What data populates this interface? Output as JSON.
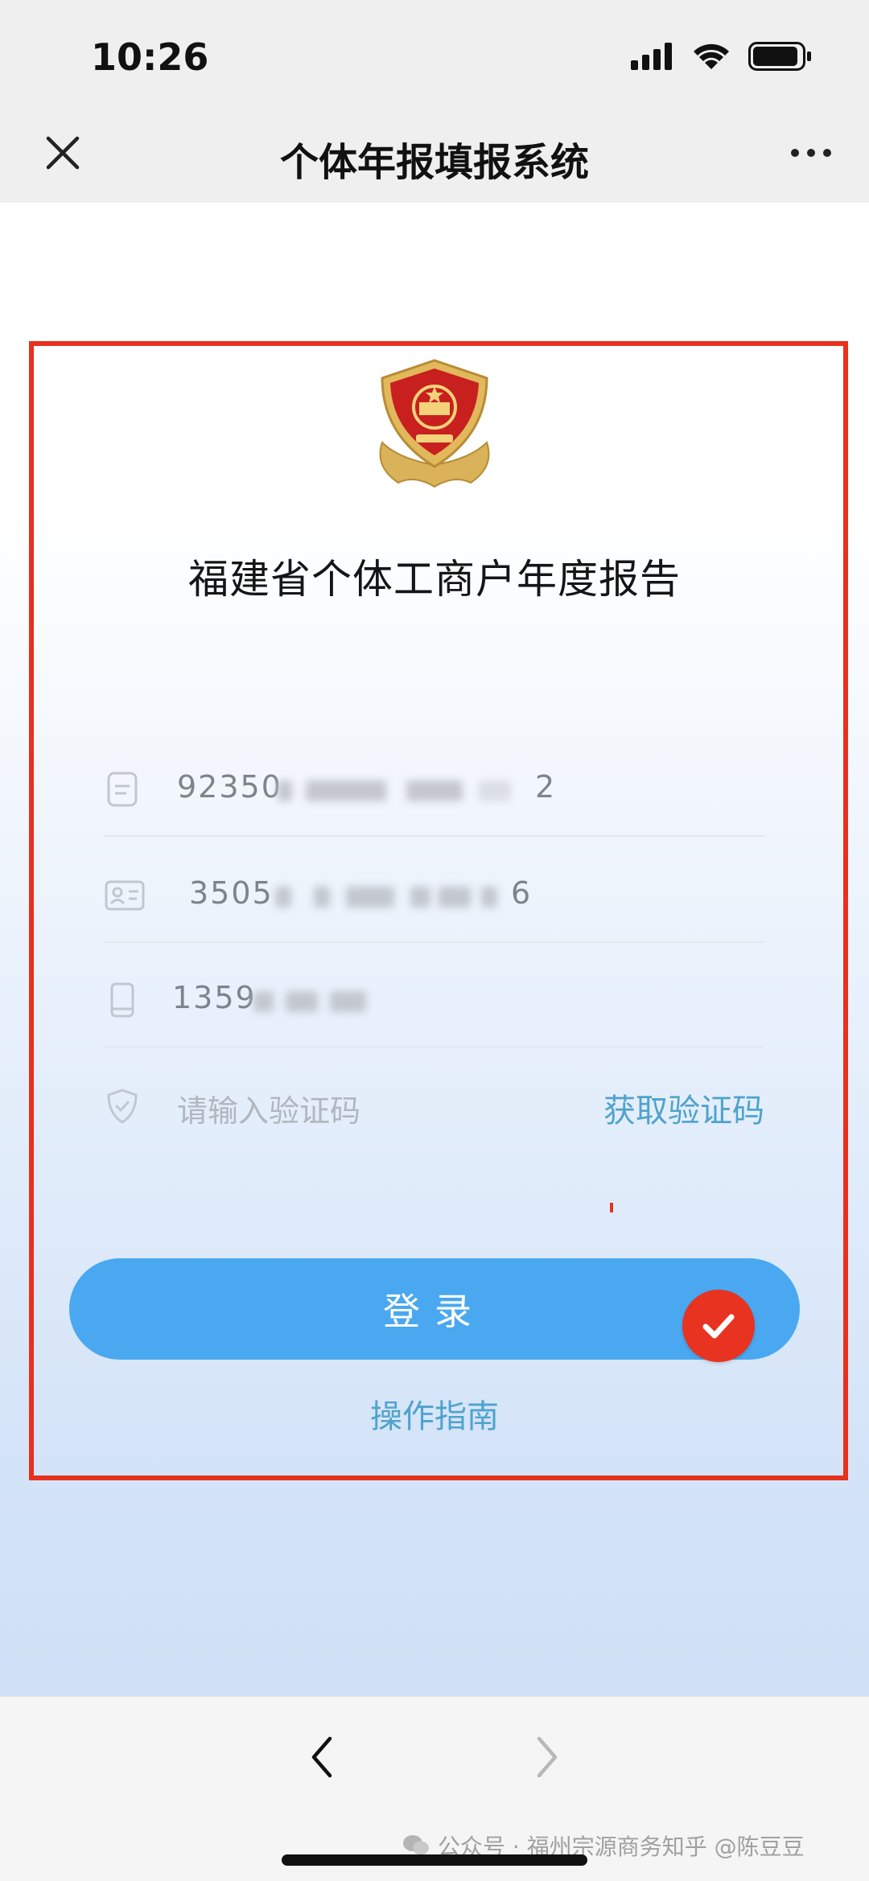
{
  "status_bar": {
    "time": "10:26"
  },
  "nav": {
    "title": "个体年报填报系统"
  },
  "form": {
    "heading": "福建省个体工商户年度报告",
    "credit_code_value": "92350",
    "credit_code_tail": "2",
    "id_number_value": "3505",
    "id_number_tail": "6",
    "phone_value": "1359",
    "code_placeholder": "请输入验证码",
    "get_code_label": "获取验证码",
    "login_label": "登录",
    "guide_label": "操作指南"
  },
  "colors": {
    "accent_blue": "#4aa8f0",
    "link_blue": "#4fa3cd",
    "highlight_red": "#e8301f"
  },
  "watermark": {
    "text": "公众号 · 福州宗源商务知乎 @陈豆豆"
  }
}
